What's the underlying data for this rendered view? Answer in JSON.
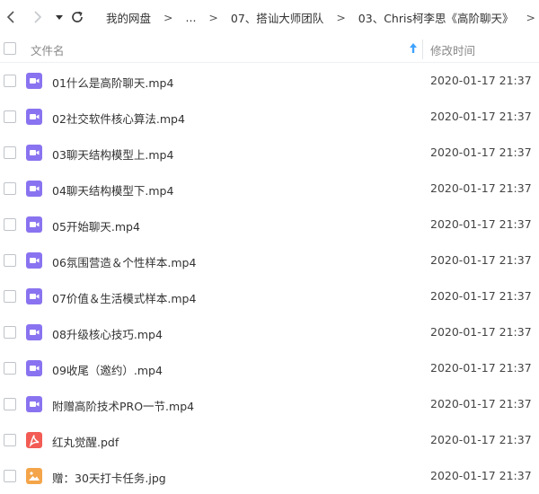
{
  "breadcrumb": {
    "root": "我的网盘",
    "ellipsis": "...",
    "folder1": "07、搭讪大师团队",
    "folder2": "03、Chris柯李思《高阶聊天》",
    "separator": ">"
  },
  "header": {
    "name_label": "文件名",
    "time_label": "修改时间"
  },
  "colors": {
    "video": "#8a73f0",
    "pdf": "#f25c54",
    "image": "#f4a54a",
    "sort_arrow": "#3fa2ff"
  },
  "files": [
    {
      "name": "01什么是高阶聊天.mp4",
      "time": "2020-01-17 21:37",
      "type": "video"
    },
    {
      "name": "02社交软件核心算法.mp4",
      "time": "2020-01-17 21:37",
      "type": "video"
    },
    {
      "name": "03聊天结构模型上.mp4",
      "time": "2020-01-17 21:37",
      "type": "video"
    },
    {
      "name": "04聊天结构模型下.mp4",
      "time": "2020-01-17 21:37",
      "type": "video"
    },
    {
      "name": "05开始聊天.mp4",
      "time": "2020-01-17 21:37",
      "type": "video"
    },
    {
      "name": "06氛围营造＆个性样本.mp4",
      "time": "2020-01-17 21:37",
      "type": "video"
    },
    {
      "name": "07价值＆生活模式样本.mp4",
      "time": "2020-01-17 21:37",
      "type": "video"
    },
    {
      "name": "08升级核心技巧.mp4",
      "time": "2020-01-17 21:37",
      "type": "video"
    },
    {
      "name": "09收尾（邀约）.mp4",
      "time": "2020-01-17 21:37",
      "type": "video"
    },
    {
      "name": "附赠高阶技术PRO一节.mp4",
      "time": "2020-01-17 21:37",
      "type": "video"
    },
    {
      "name": "红丸觉醒.pdf",
      "time": "2020-01-17 21:37",
      "type": "pdf"
    },
    {
      "name": "赠：30天打卡任务.jpg",
      "time": "2020-01-17 21:37",
      "type": "image"
    }
  ]
}
